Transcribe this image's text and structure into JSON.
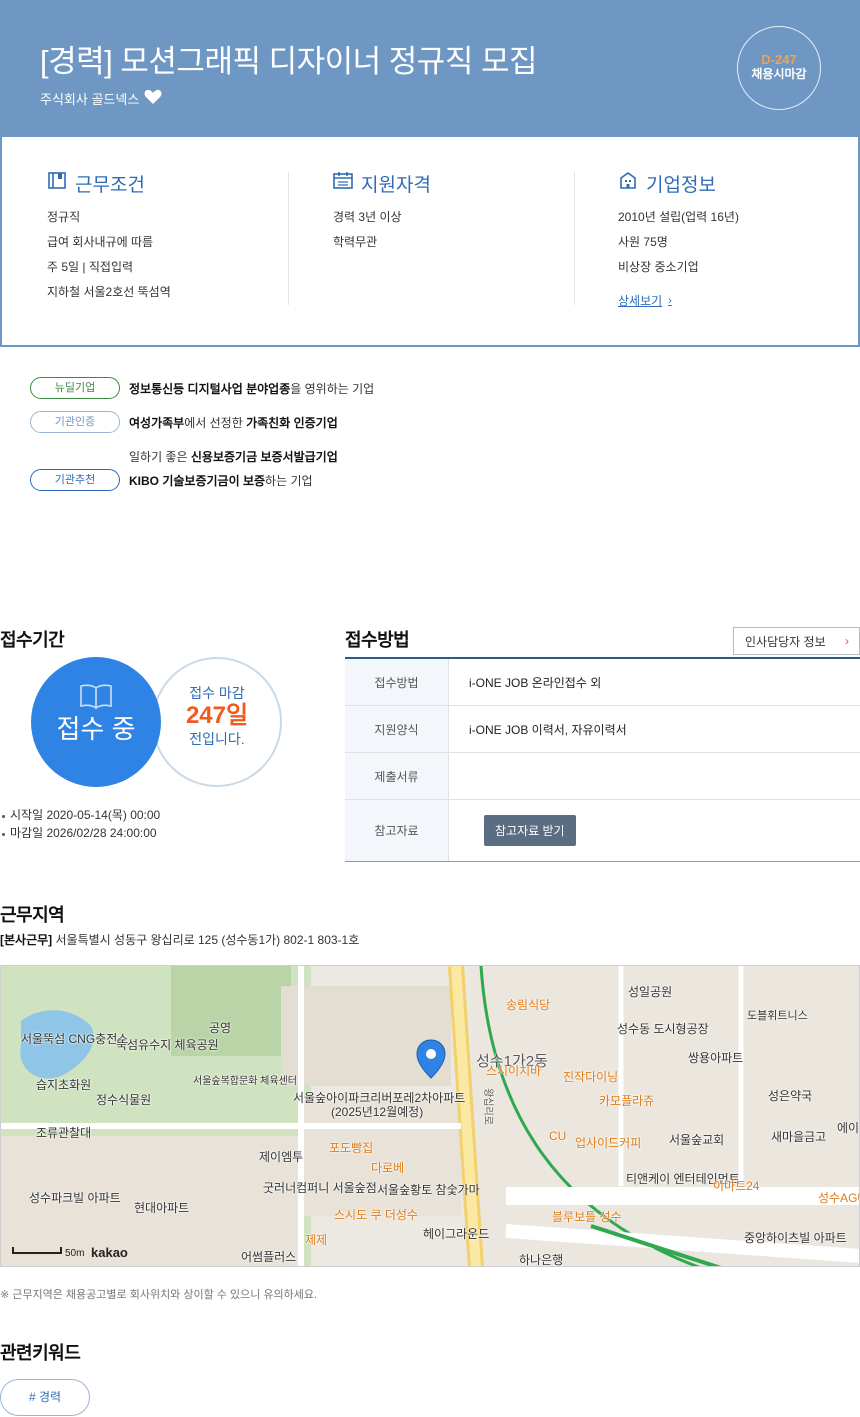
{
  "header": {
    "title": "[경력] 모션그래픽 디자이너 정규직 모집",
    "company": "주식회사 골드넥스",
    "dday": "D-247",
    "deadline_label": "채용시마감"
  },
  "conditions": {
    "work": {
      "title": "근무조건",
      "items": [
        "정규직",
        "급여 회사내규에 따름",
        "주 5일 | 직접입력",
        "지하철 서울2호선 뚝섬역"
      ]
    },
    "qual": {
      "title": "지원자격",
      "items": [
        "경력 3년 이상",
        "학력무관"
      ]
    },
    "company": {
      "title": "기업정보",
      "items": [
        "2010년 설립(업력 16년)",
        "사원 75명",
        "비상장 중소기업"
      ],
      "detail_link": "상세보기"
    }
  },
  "badges": [
    {
      "label": "뉴딜기업",
      "parts": [
        {
          "t": "정보통신등 디지털사업 분야업종",
          "b": true
        },
        {
          "t": "을 영위하는 기업",
          "b": false
        }
      ],
      "color": "#3a8a3f"
    },
    {
      "label": "기관인증",
      "parts": [
        {
          "t": "여성가족부",
          "b": true
        },
        {
          "t": "에서 선정한 ",
          "b": false
        },
        {
          "t": "가족친화 인증기업",
          "b": true
        }
      ],
      "color": "#6f97c3"
    },
    {
      "label": "기관추천",
      "line1": [
        {
          "t": "일하기 좋은 ",
          "b": false
        },
        {
          "t": "신용보증기금 보증서발급기업",
          "b": true
        }
      ],
      "parts": [
        {
          "t": "KIBO 기술보증기금이 보증",
          "b": true
        },
        {
          "t": "하는 기업",
          "b": false
        }
      ],
      "color": "#2f6bb7"
    }
  ],
  "period": {
    "title": "접수기간",
    "status": "접수 중",
    "remain_label": "접수 마감",
    "remain_days": "247일",
    "remain_suffix": "전입니다.",
    "start": "시작일 2020-05-14(목) 00:00",
    "end": "마감일 2026/02/28 24:00:00"
  },
  "apply": {
    "title": "접수방법",
    "hr_button": "인사담당자 정보",
    "rows": [
      {
        "th": "접수방법",
        "td": "i-ONE JOB 온라인접수 외"
      },
      {
        "th": "지원양식",
        "td": "i-ONE JOB 이력서, 자유이력서"
      },
      {
        "th": "제출서류",
        "td": ""
      },
      {
        "th": "참고자료",
        "td": "참고자료 받기"
      }
    ]
  },
  "location": {
    "title": "근무지역",
    "tag": "[본사근무]",
    "address": "서울특별시 성동구 왕십리로 125 (성수동1가) 802-1 803-1호",
    "notice": "※ 근무지역은 채용공고별로 회사위치와 상이할 수 있으니 유의하세요.",
    "map": {
      "scale": "50m",
      "brand": "kakao",
      "labels": [
        "서울뚝섬 CNG충전소",
        "뚝섬유수지 체육공원",
        "습지초화원",
        "정수식물원",
        "조류관찰대",
        "서울숲복합문화 체육센터",
        "공영",
        "서울숲아이파크리버포레2차아파트",
        "(2025년12월예정)",
        "제이엠투",
        "포도빵집",
        "다로베",
        "굿러너컴퍼니 서울숲점",
        "서울숲황토 참숯가마",
        "헤이그라운드",
        "성수파크빌 아파트",
        "현대아파트",
        "어썸플러스",
        "송림식당",
        "성일공원",
        "성수동 도시형공장",
        "쌍용아파트",
        "성수1가2동",
        "스시이치바",
        "진작다이닝",
        "카모플라쥬",
        "CU",
        "업사이드커피",
        "서울숲교회",
        "성은약국",
        "새마을금고",
        "티앤케이 엔터테인먼트",
        "이마트24",
        "블루보틀 성수",
        "중앙하이츠빌 아파트",
        "하나은행",
        "도블휘트니스",
        "스시도 쿠 더성수",
        "제제",
        "왕십리로",
        "성수AGU",
        "에이"
      ]
    }
  },
  "keywords": {
    "title": "관련키워드",
    "items": [
      "# 경력"
    ]
  },
  "colors": {
    "header": "#6f97c3",
    "accent": "#2f6bb7",
    "status_blue": "#2f83e4",
    "dday_orange": "#f5a04f",
    "remain_orange": "#f25a1d"
  }
}
